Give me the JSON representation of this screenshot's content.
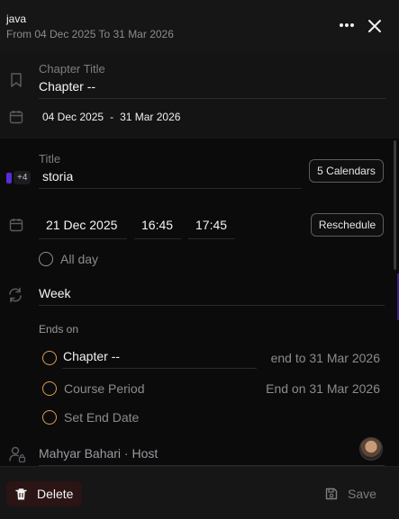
{
  "header": {
    "title": "java",
    "subtitle": "From 04 Dec 2025 To 31 Mar 2026",
    "more_icon": "more-horizontal-icon",
    "close_icon": "close-icon"
  },
  "chapter": {
    "label": "Chapter Title",
    "value": "Chapter --",
    "date_start": "04 Dec 2025",
    "date_sep": "-",
    "date_end": "31 Mar 2026"
  },
  "event": {
    "title_label": "Title",
    "title_value": "storia",
    "color": "#5b2bd9",
    "more_count": "+4",
    "calendars_button": "5 Calendars",
    "date": "21 Dec 2025",
    "start_time": "16:45",
    "end_time": "17:45",
    "reschedule_button": "Reschedule",
    "all_day_label": "All day",
    "repeat_value": "Week",
    "ends_on_label": "Ends on",
    "ends_options": [
      {
        "label": "Chapter --",
        "right": "end to 31 Mar 2026",
        "selected": false
      },
      {
        "label": "Course Period",
        "right": "End on 31 Mar 2026",
        "selected": false
      },
      {
        "label": "Set End Date",
        "right": "",
        "selected": false
      }
    ],
    "host": "Mahyar Bahari · Host"
  },
  "footer": {
    "delete_label": "Delete",
    "save_label": "Save"
  },
  "colors": {
    "accent_purple": "#5b2bd9",
    "radio_orange": "#e09a4f",
    "delete_bg": "#2a1414"
  }
}
